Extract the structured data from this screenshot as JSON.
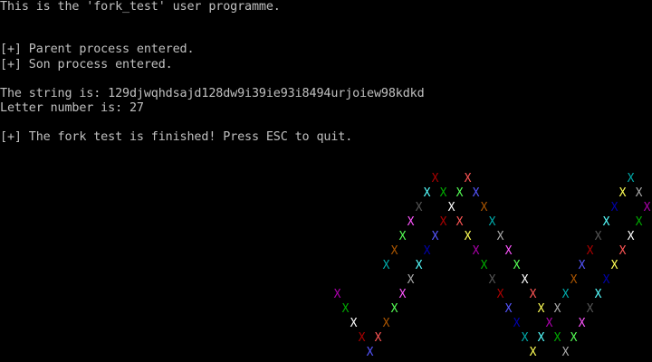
{
  "console": {
    "lines": [
      "This is the 'fork_test' user programme.",
      "[+] Parent process entered.",
      "[+] Son process entered.",
      "The string is: 129djwqhdsajd128dw9i39ie93i8494urjoiew98kdkd",
      "Letter number is: 27",
      "[+] The fork test is finished! Press ESC to quit."
    ]
  },
  "pattern": {
    "glyph": "X",
    "palette": [
      "#5555ff",
      "#00aa00",
      "#00aaaa",
      "#aa0000",
      "#aa00aa",
      "#aa5500",
      "#555555",
      "#ffff55",
      "#55ff55",
      "#55ffff",
      "#ff5555",
      "#ff55ff",
      "#0000aa",
      "#ffffff",
      "#aaaaaa"
    ]
  }
}
